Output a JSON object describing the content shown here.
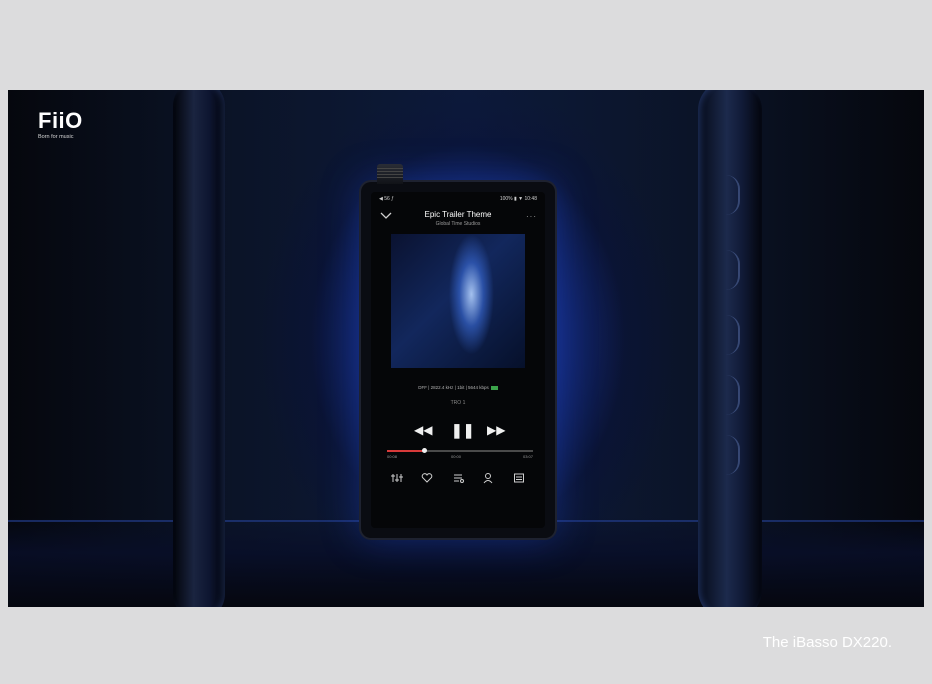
{
  "logo": {
    "mark": "FiiO",
    "tagline": "Born for music"
  },
  "player": {
    "status_left": "◀ 56 ƒ",
    "status_right": "100% ▮ ▼ 10:48",
    "track_title": "Epic Trailer Theme",
    "track_artist": "Global Time Studios",
    "audio_info": "DFF | 2822.4 kHz | 1bit | 5644 kbps",
    "queue_position": "TRO 1",
    "time_elapsed": "00:08",
    "time_middle": "00:00",
    "time_total": "03:07",
    "progress": 0.25
  },
  "caption": "The iBasso DX220.",
  "colors": {
    "accent": "#d83a3a",
    "glow": "#2a5ae6"
  }
}
